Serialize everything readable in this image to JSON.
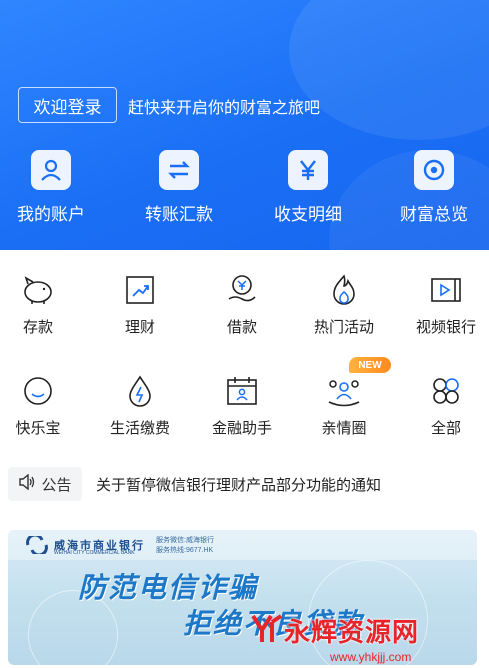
{
  "header": {
    "login_button": "欢迎登录",
    "login_tip": "赶快来开启你的财富之旅吧"
  },
  "quick_actions": [
    {
      "label": "我的账户",
      "icon": "user-icon"
    },
    {
      "label": "转账汇款",
      "icon": "transfer-icon"
    },
    {
      "label": "收支明细",
      "icon": "yuan-icon"
    },
    {
      "label": "财富总览",
      "icon": "overview-icon"
    }
  ],
  "services_row1": [
    {
      "label": "存款",
      "icon": "piggy-bank-icon"
    },
    {
      "label": "理财",
      "icon": "trend-chart-icon"
    },
    {
      "label": "借款",
      "icon": "loan-icon"
    },
    {
      "label": "热门活动",
      "icon": "flame-icon"
    },
    {
      "label": "视频银行",
      "icon": "video-icon"
    }
  ],
  "services_row2": [
    {
      "label": "快乐宝",
      "icon": "smile-icon"
    },
    {
      "label": "生活缴费",
      "icon": "bolt-drop-icon"
    },
    {
      "label": "金融助手",
      "icon": "calendar-person-icon"
    },
    {
      "label": "亲情圈",
      "icon": "family-icon",
      "badge": "NEW"
    },
    {
      "label": "全部",
      "icon": "grid-all-icon"
    }
  ],
  "notice": {
    "tag": "公告",
    "text": "关于暂停微信银行理财产品部分功能的通知"
  },
  "banner": {
    "bank_name": "威海市商业银行",
    "bank_en": "WEIHAI CITY COMMERCIAL BANK",
    "contact_line1": "服务微信:威海银行",
    "contact_line2": "服务热线:9677.HK",
    "title_line1": "防范电信诈骗",
    "title_line2": "拒绝不良贷款"
  },
  "watermark": {
    "text": "永辉资源网",
    "url": "www.yhkjjj.com"
  },
  "colors": {
    "hero_blue": "#1a6ff5",
    "icon_blue": "#1a6ff5",
    "badge_orange": "#ff9a2e",
    "watermark_red": "#e8242b"
  }
}
